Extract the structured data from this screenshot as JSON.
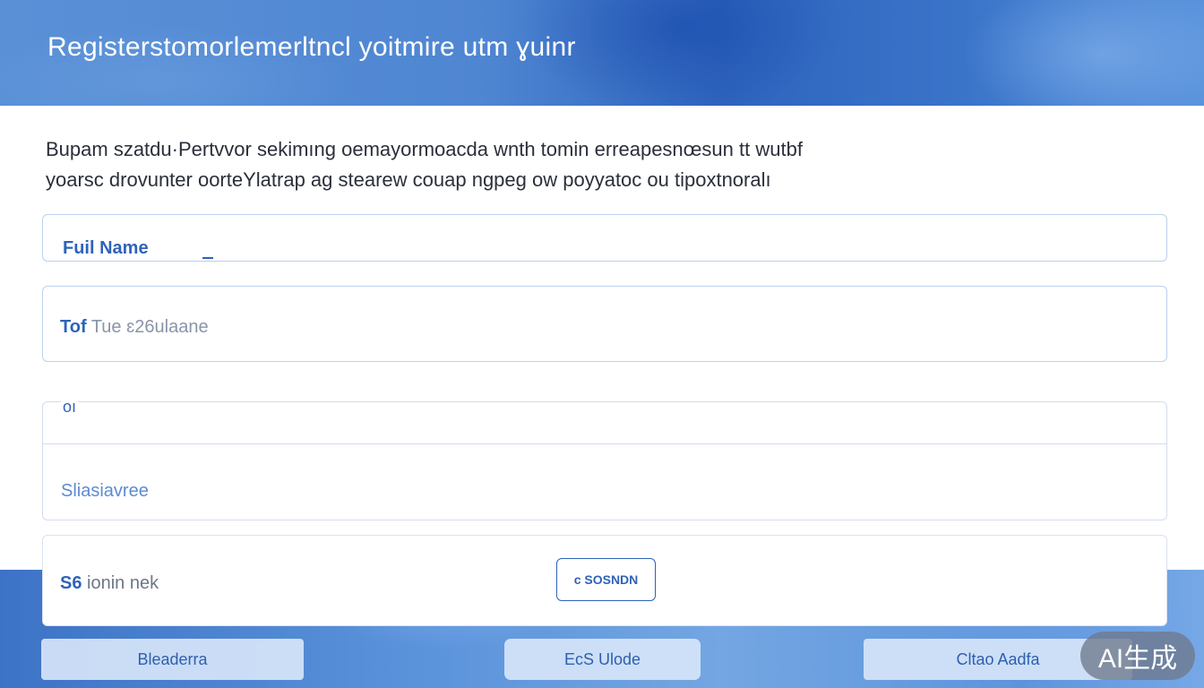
{
  "header": {
    "title": "Registerstomorlemerltncl yoitmire utm ɣuinr"
  },
  "intro": {
    "line1": "Bupam szatdu·Pertvvor sekimıng oemayormoacda wnth tomin erreapesnœsun tt wutbf",
    "line2": "yoarsc drovunter oorteYlatrap ag stearew couap ngpeg ow poyyatoc ou tipoxtnoralı"
  },
  "form": {
    "full_name": {
      "label": "Fuil Name"
    },
    "name_field": {
      "prefix": "Tof",
      "value": "Tue ɛ26ulaane"
    },
    "section": {
      "label": "oı",
      "value": "Sliasiavree"
    },
    "code_field": {
      "prefix": "S6",
      "value": "ionin nek",
      "button_label": "ᴄ SOSNDN"
    }
  },
  "buttons": {
    "left": "Bleaderra",
    "center": "EcS Ulode",
    "right": "Cltao Aadfa"
  },
  "watermark": "AI生成",
  "colors": {
    "accent": "#2f63b8",
    "header_blue": "#3a74c9",
    "field_border": "#bcd0ee"
  }
}
